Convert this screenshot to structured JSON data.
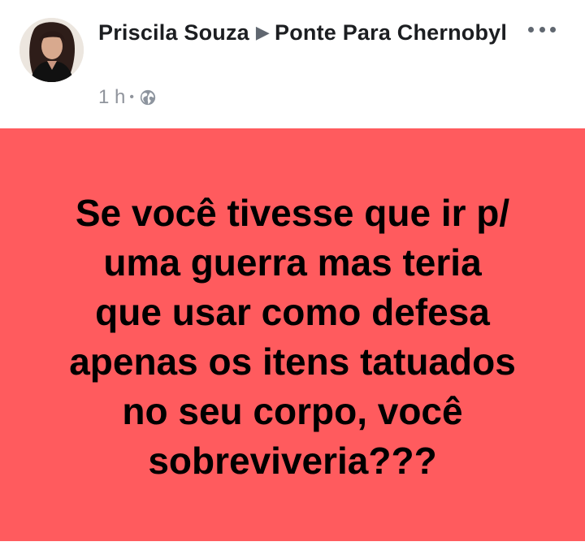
{
  "post": {
    "author": "Priscila Souza",
    "group": "Ponte Para Chernobyl",
    "time": "1 h",
    "separator": "•",
    "privacy_icon": "globe-icon",
    "more_icon": "more-options-icon",
    "body_text": "Se você tivesse que ir p/\numa guerra mas teria\nque usar como defesa\napenas os itens tatuados\nno seu corpo, você\nsobreviveria???",
    "background_color": "#ff5b5e"
  }
}
